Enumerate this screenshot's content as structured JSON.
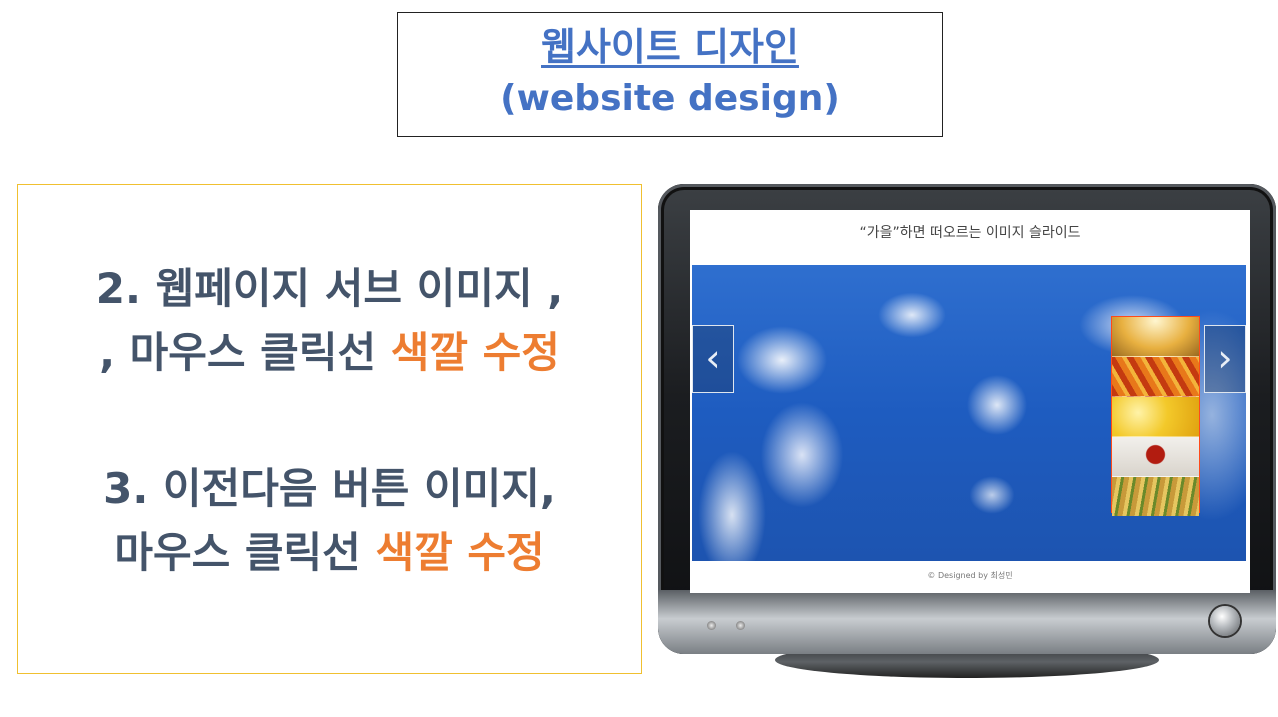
{
  "title": {
    "korean": "웹사이트 디자인",
    "english": "(website design)"
  },
  "tasks": {
    "line1": "2. 웹페이지 서브 이미지 ,",
    "line2_prefix": ", 마우스 클릭선 ",
    "line2_accent": "색깔 수정",
    "line3": "3. 이전다음 버튼 이미지,",
    "line4_prefix": "마우스 클릭선 ",
    "line4_accent": "색깔 수정"
  },
  "screen": {
    "heading": "“가을”하면 떠오르는 이미지 슬라이드",
    "footer": "© Designed by 최성민",
    "thumbnails": [
      "sunlight-leaves",
      "red-autumn-leaves",
      "yellow-ginkgo",
      "maple-leaf-book",
      "rice-field"
    ]
  },
  "colors": {
    "title": "#4472c4",
    "body_text": "#44546a",
    "accent": "#ed7d31",
    "thumb_border": "#ff4a1a"
  }
}
